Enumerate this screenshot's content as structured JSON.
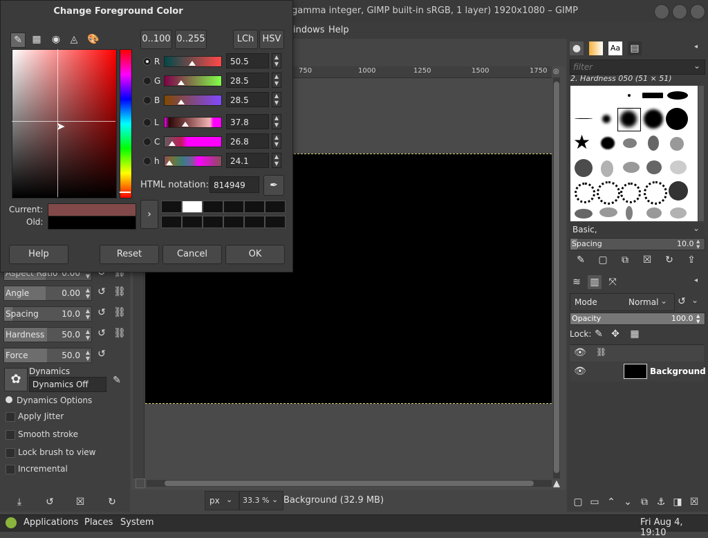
{
  "window": {
    "title": "gamma integer, GIMP built-in sRGB, 1 layer) 1920x1080 – GIMP"
  },
  "menubar": {
    "windows": "indows",
    "help": "Help"
  },
  "ruler": {
    "t750": "750",
    "t1000": "1000",
    "t1250": "1250",
    "t1500": "1500",
    "t1750": "1750"
  },
  "dialog": {
    "title": "Change Foreground Color",
    "range_0_100": "0..100",
    "range_0_255": "0..255",
    "lch": "LCh",
    "hsv": "HSV",
    "channels": [
      {
        "label": "R",
        "value": "50.5"
      },
      {
        "label": "G",
        "value": "28.5"
      },
      {
        "label": "B",
        "value": "28.5"
      },
      {
        "label": "L",
        "value": "37.8"
      },
      {
        "label": "C",
        "value": "26.8"
      },
      {
        "label": "h",
        "value": "24.1"
      }
    ],
    "html_label": "HTML notation:",
    "html_value": "814949",
    "current_label": "Current:",
    "old_label": "Old:",
    "current_color": "#814949",
    "old_color": "#000000",
    "buttons": {
      "help": "Help",
      "reset": "Reset",
      "cancel": "Cancel",
      "ok": "OK"
    }
  },
  "tool_options": {
    "aspect_label": "Aspect Ratio",
    "aspect_value": "0.00",
    "angle_label": "Angle",
    "angle_value": "0.00",
    "spacing_label": "Spacing",
    "spacing_value": "10.0",
    "hardness_label": "Hardness",
    "hardness_value": "50.0",
    "force_label": "Force",
    "force_value": "50.0",
    "dynamics_label": "Dynamics",
    "dynamics_value": "Dynamics Off",
    "dynamics_options": "Dynamics Options",
    "apply_jitter": "Apply Jitter",
    "smooth_stroke": "Smooth stroke",
    "lock_brush": "Lock brush to view",
    "incremental": "Incremental"
  },
  "statusbar": {
    "unit": "px",
    "zoom": "33.3 %",
    "info": "Background (32.9 MB)"
  },
  "brushes": {
    "filter_placeholder": "filter",
    "selected": "2. Hardness 050 (51 × 51)",
    "tag": "Basic,",
    "spacing_label": "Spacing",
    "spacing_value": "10.0"
  },
  "layers": {
    "mode_label": "Mode",
    "mode_value": "Normal",
    "opacity_label": "Opacity",
    "opacity_value": "100.0",
    "lock_label": "Lock:",
    "layer_name": "Background"
  },
  "taskbar": {
    "applications": "Applications",
    "places": "Places",
    "system": "System",
    "clock": "Fri Aug  4, 19:10"
  }
}
